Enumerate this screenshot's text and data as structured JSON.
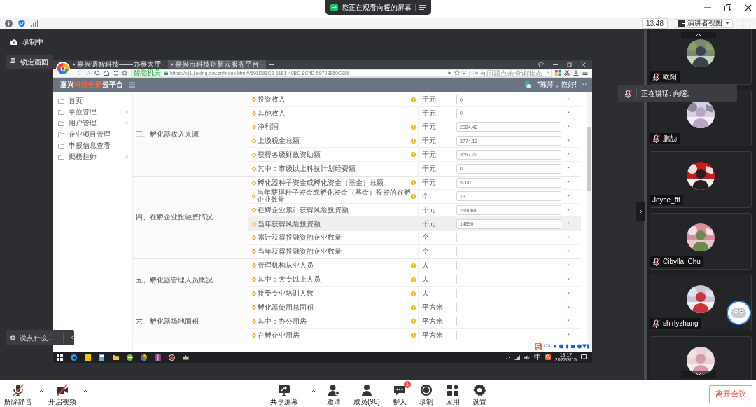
{
  "title_bar": {
    "banner": "您正在观看向暖的屏幕"
  },
  "toolbar": {
    "time": "13:48",
    "view_button": "演讲者视图"
  },
  "recording": {
    "label": "录制中"
  },
  "lock_button": "锁定画面",
  "shared_screen": {
    "browser": {
      "tabs": [
        {
          "label": "嘉兴调智科技——办事大厅",
          "selected": false
        },
        {
          "label": "嘉兴市科技创新云服务平台",
          "selected": true
        }
      ],
      "secure_label": "智能机关",
      "url": "https://kjj1.jiaxing.gov.cn/index.html#/591D98C2-6181-40BC-8C4D-59703850C986",
      "search_placeholder": "有问题点击查询状态"
    },
    "app": {
      "brand": {
        "prefix": "嘉兴",
        "highlight": "科技创新",
        "suffix": "云平台"
      },
      "greeting": "*陈萍，您好!",
      "sidebar": [
        {
          "label": "首页",
          "has_children": false
        },
        {
          "label": "单位管理",
          "has_children": true
        },
        {
          "label": "用户管理",
          "has_children": true
        },
        {
          "label": "企业项目管理",
          "has_children": false
        },
        {
          "label": "申报信息查看",
          "has_children": false
        },
        {
          "label": "揭榜挂帅",
          "has_children": true
        }
      ],
      "sections": [
        {
          "title": "三、孵化器收入来源",
          "rows": [
            {
              "label": "投资收入",
              "info": true,
              "unit": "千元",
              "value": "0",
              "required_mark": "*",
              "highlighted": false
            },
            {
              "label": "其他收入",
              "info": false,
              "unit": "千元",
              "value": "0",
              "required_mark": "*",
              "highlighted": false
            },
            {
              "label": "净利润",
              "info": true,
              "unit": "千元",
              "value": "2084.42",
              "required_mark": "*",
              "highlighted": false
            },
            {
              "label": "上缴税金总额",
              "info": true,
              "unit": "千元",
              "value": "2774.13",
              "required_mark": "*",
              "highlighted": false
            },
            {
              "label": "获得各级财政资助额",
              "info": true,
              "unit": "千元",
              "value": "3697.22",
              "required_mark": "*",
              "highlighted": false
            },
            {
              "label": "其中：市级以上科技计划经费额",
              "info": false,
              "unit": "千元",
              "value": "0",
              "required_mark": "*",
              "highlighted": false
            }
          ]
        },
        {
          "title": "四、在孵企业投融资情况",
          "rows": [
            {
              "label": "孵化器种子资金或孵化资金（基金）总额",
              "info": true,
              "unit": "千元",
              "value": "5000",
              "required_mark": "*",
              "highlighted": false
            },
            {
              "label": "当年获得种子资金或孵化资金（基金）投资的在孵企业数量",
              "info": true,
              "unit": "个",
              "value": "13",
              "required_mark": "*",
              "highlighted": false
            },
            {
              "label": "在孵企业累计获得风险投资额",
              "info": false,
              "unit": "千元",
              "value": "219060",
              "required_mark": "*",
              "highlighted": false
            },
            {
              "label": "当年获得风险投资额",
              "info": false,
              "unit": "千元",
              "value": "14890",
              "required_mark": "*",
              "highlighted": true
            },
            {
              "label": "累计获得投融资的企业数量",
              "info": false,
              "unit": "个",
              "required_mark": "*",
              "highlighted": false
            },
            {
              "label": "当年获得投融资的企业数量",
              "info": false,
              "unit": "个",
              "required_mark": "*",
              "highlighted": false
            }
          ]
        },
        {
          "title": "五、孵化器管理人员概况",
          "rows": [
            {
              "label": "管理机构从业人员",
              "info": true,
              "unit": "人",
              "required_mark": "*",
              "highlighted": false
            },
            {
              "label": "其中：大专以上人员",
              "info": true,
              "unit": "人",
              "required_mark": "*",
              "highlighted": false
            },
            {
              "label": "接受专业培训人数",
              "info": true,
              "unit": "人",
              "required_mark": "*",
              "highlighted": false
            }
          ]
        },
        {
          "title": "六、孵化器场地面积",
          "rows": [
            {
              "label": "孵化器使用总面积",
              "info": true,
              "unit": "平方米",
              "required_mark": "*",
              "highlighted": false
            },
            {
              "label": "其中：办公用房",
              "info": true,
              "unit": "平方米",
              "required_mark": "*",
              "highlighted": false
            },
            {
              "label": "在孵企业用房",
              "info": true,
              "unit": "平方米",
              "required_mark": "*",
              "highlighted": false
            }
          ]
        }
      ]
    },
    "ime": {
      "mode": "中"
    },
    "taskbar": {
      "ime": "中",
      "time": "13:17",
      "date": "2022/3/15"
    }
  },
  "chat_input": {
    "placeholder": "说点什么..."
  },
  "speaking": "正在讲话: 向暖;",
  "participants": [
    {
      "kind": "picture",
      "name": "欧阳",
      "muted": true
    },
    {
      "kind": "picture",
      "name": "鹏劼",
      "muted": true
    },
    {
      "kind": "picture",
      "name": "Joyce_fff",
      "muted": false
    },
    {
      "kind": "picture",
      "name": "Cibylla_Chu",
      "muted": true
    },
    {
      "kind": "picture",
      "name": "shirlyzhang",
      "muted": true
    },
    {
      "kind": "picture"
    }
  ],
  "bottom_bar": {
    "left": [
      {
        "kind": "mic",
        "label": "解除静音",
        "off": true
      },
      {
        "kind": "camera",
        "label": "开启视频",
        "off": true
      }
    ],
    "center": [
      {
        "kind": "share",
        "label": "共享屏幕"
      },
      {
        "kind": "invite",
        "label": "邀请"
      },
      {
        "kind": "members",
        "label": "成员(96)"
      },
      {
        "kind": "chat",
        "label": "聊天",
        "badge": "1"
      },
      {
        "kind": "record",
        "label": "录制"
      },
      {
        "kind": "apps",
        "label": "应用"
      },
      {
        "kind": "settings",
        "label": "设置"
      }
    ],
    "leave": "离开会议"
  }
}
